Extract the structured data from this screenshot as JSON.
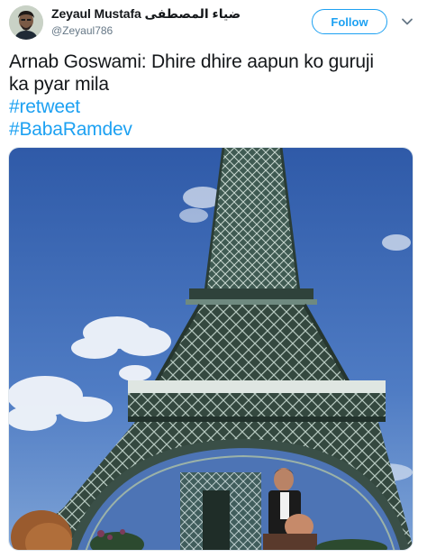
{
  "author": {
    "display_name": "Zeyaul Mustafa ضياء المصطفى",
    "handle": "@Zeyaul786",
    "avatar_icon": "person-avatar"
  },
  "actions": {
    "follow_label": "Follow",
    "more_icon": "chevron-down-icon"
  },
  "tweet": {
    "text_line1": "Arnab Goswami: Dhire dhire aapun ko guruji",
    "text_line2": "ka pyar mila",
    "hashtags": [
      "#retweet",
      "#BabaRamdev"
    ]
  },
  "media": {
    "type": "photo",
    "content": "edited-photo-eiffel-tower"
  },
  "colors": {
    "accent": "#1da1f2",
    "text": "#14171a",
    "secondary": "#657786"
  }
}
